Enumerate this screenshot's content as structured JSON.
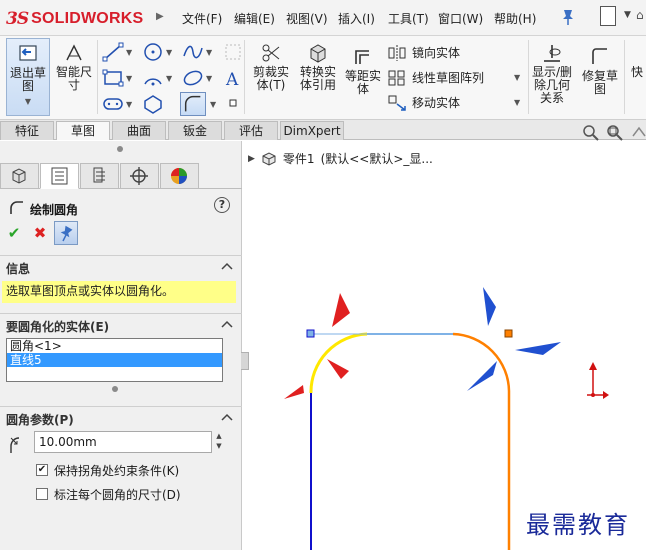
{
  "app": {
    "brand": "SOLIDWORKS",
    "brand_color": "#d71e2b"
  },
  "menu": [
    "文件(F)",
    "编辑(E)",
    "视图(V)",
    "插入(I)",
    "工具(T)",
    "窗口(W)",
    "帮助(H)"
  ],
  "ribbon": {
    "exit_sketch": "退出草图",
    "smart_dim": "智能尺寸",
    "trim": "剪裁实体(T)",
    "convert": "转换实体引用",
    "offset": "等距实体",
    "mirror": "镜向实体",
    "linear_pattern": "线性草图阵列",
    "move": "移动实体",
    "show_relations": "显示/删除几何关系",
    "repair": "修复草图",
    "quick": "快"
  },
  "tabs": [
    "特征",
    "草图",
    "曲面",
    "钣金",
    "评估",
    "DimXpert"
  ],
  "active_tab": "草图",
  "tree": {
    "part": "零件1",
    "config": "(默认<<默认>_显..."
  },
  "property_manager": {
    "title": "绘制圆角",
    "help": "?",
    "info_header": "信息",
    "info_message": "选取草图顶点或实体以圆角化。",
    "entities_header": "要圆角化的实体(E)",
    "entities": [
      "圆角<1>",
      "直线5"
    ],
    "selected_entity_index": 1,
    "params_header": "圆角参数(P)",
    "radius": "10.00mm",
    "keep_constrained_corners": "保持拐角处约束条件(K)",
    "keep_constrained_checked": true,
    "dimension_each_fillet": "标注每个圆角的尺寸(D)",
    "dimension_each_checked": false
  },
  "watermark": "最需教育",
  "colors": {
    "info_bg": "#ffff88",
    "selection": "#3399ff",
    "sketch_blue": "#1010cc",
    "fillet_yellow": "#ffe800",
    "fillet_orange": "#ff8000",
    "callout_red": "#e02020",
    "callout_blue": "#2050d0"
  }
}
